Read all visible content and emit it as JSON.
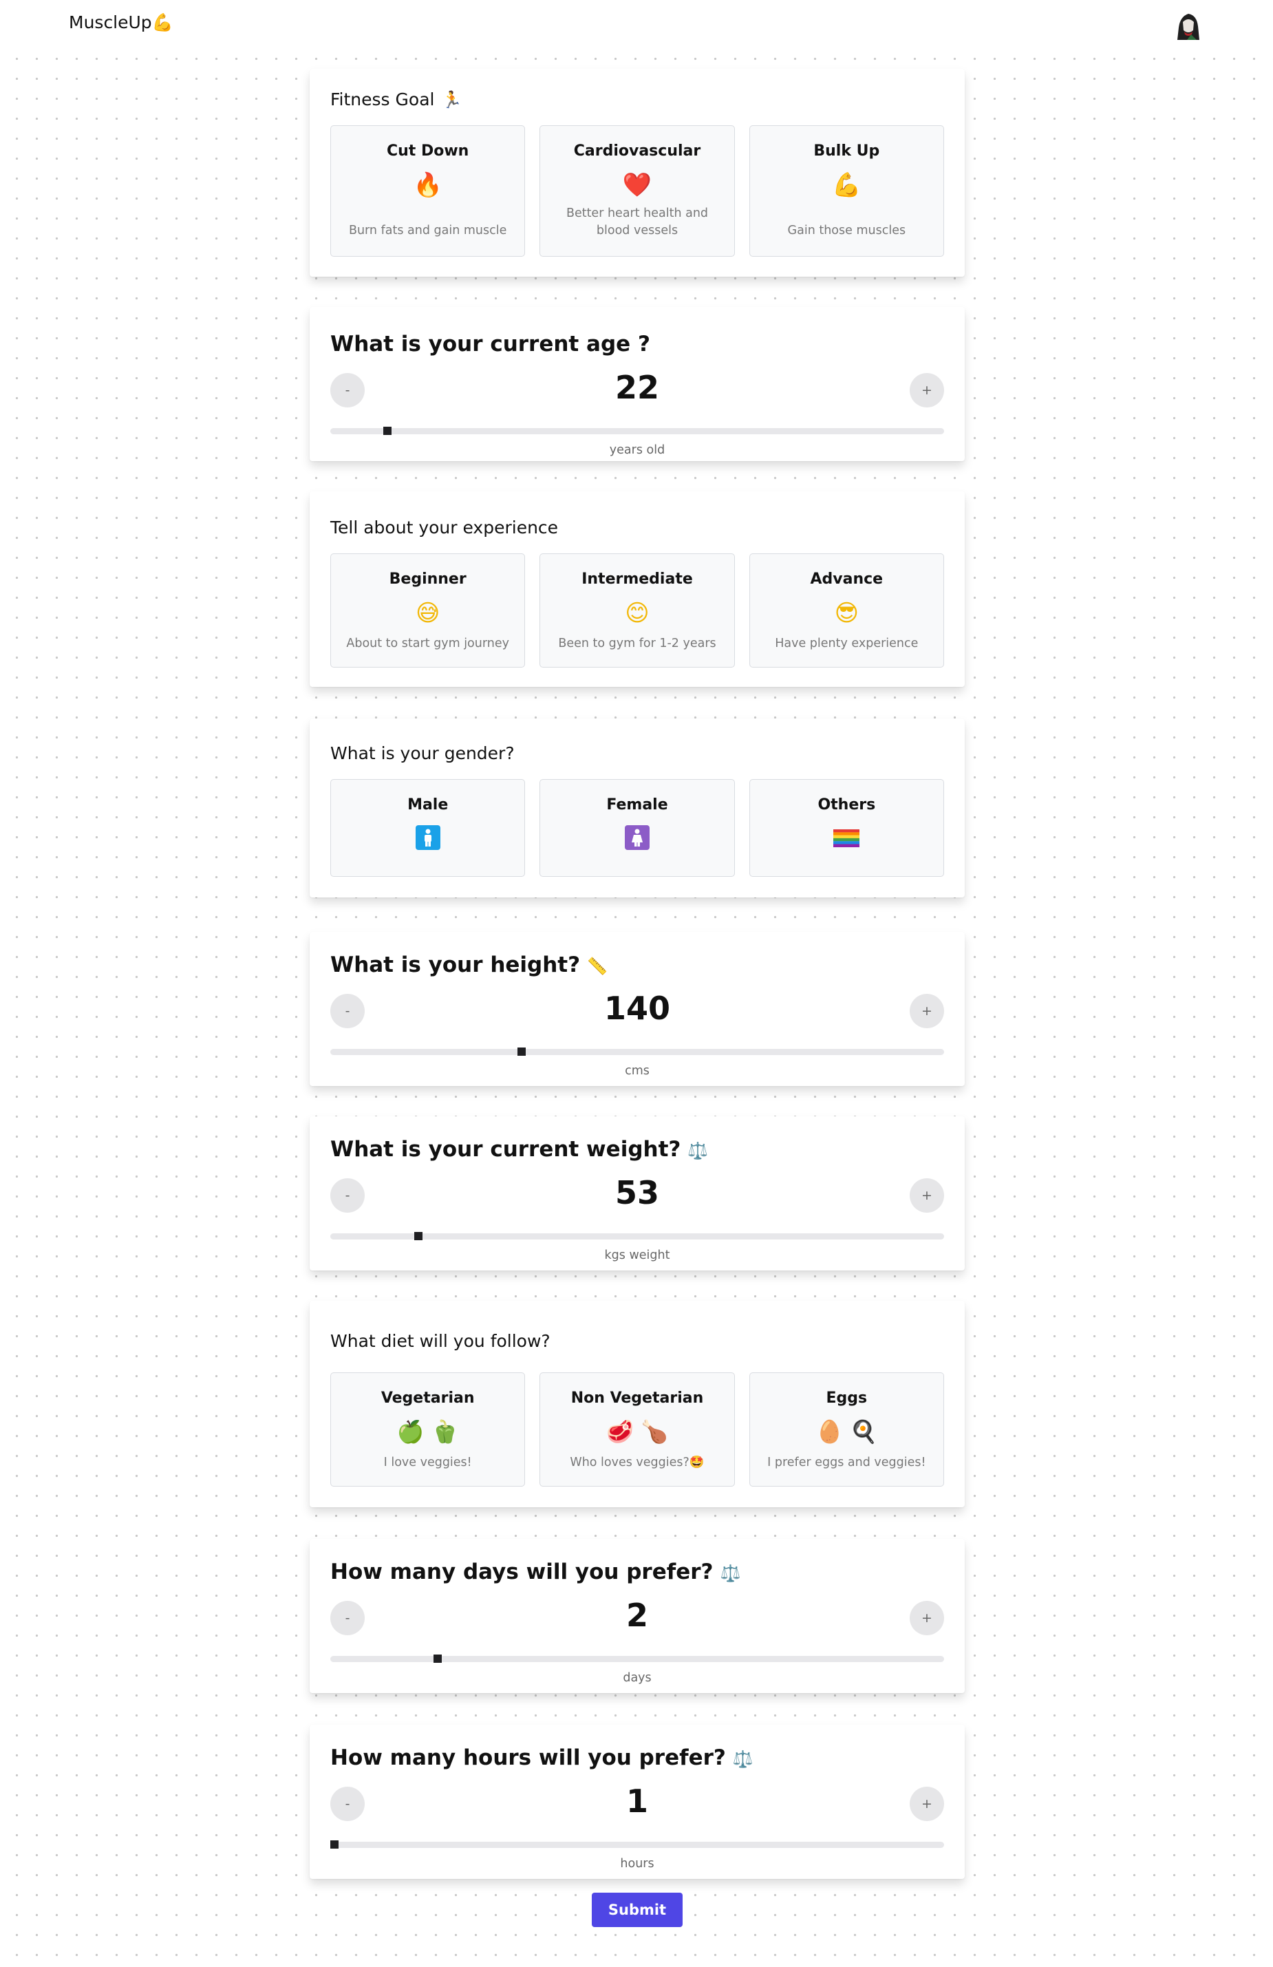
{
  "header": {
    "brand": "MuscleUp",
    "brand_icon": "💪"
  },
  "goal": {
    "title": "Fitness Goal",
    "title_icon": "🏃",
    "options": [
      {
        "title": "Cut Down",
        "icon": "🔥",
        "desc": "Burn fats and gain muscle"
      },
      {
        "title": "Cardiovascular",
        "icon": "❤️",
        "desc": "Better heart health and blood vessels"
      },
      {
        "title": "Bulk Up",
        "icon": "💪",
        "desc": "Gain those muscles"
      }
    ]
  },
  "age": {
    "title": "What is your current age ?",
    "value": "22",
    "unit": "years old",
    "minus": "-",
    "plus": "+",
    "level": 0.087
  },
  "experience": {
    "title": "Tell about your experience",
    "options": [
      {
        "title": "Beginner",
        "icon": "😅",
        "desc": "About to start gym journey"
      },
      {
        "title": "Intermediate",
        "icon": "😊",
        "desc": "Been to gym for 1-2 years"
      },
      {
        "title": "Advance",
        "icon": "😎",
        "desc": "Have plenty experience"
      }
    ]
  },
  "gender": {
    "title": "What is your gender?",
    "options": [
      {
        "title": "Male",
        "icon": "🚹"
      },
      {
        "title": "Female",
        "icon": "🚺"
      },
      {
        "title": "Others",
        "icon": "🏳️‍🌈"
      }
    ]
  },
  "height": {
    "title": "What is your height?",
    "title_icon": "📏",
    "value": "140",
    "unit": "cms",
    "minus": "-",
    "plus": "+",
    "level": 0.309
  },
  "weight": {
    "title": "What is your current weight?",
    "title_icon": "⚖️",
    "value": "53",
    "unit": "kgs weight",
    "minus": "-",
    "plus": "+",
    "level": 0.139
  },
  "diet": {
    "title": "What diet will you follow?",
    "options": [
      {
        "title": "Vegetarian",
        "icons": [
          "🍏",
          "🫑"
        ],
        "desc": "I love veggies!"
      },
      {
        "title": "Non Vegetarian",
        "icons": [
          "🥩",
          "🍗"
        ],
        "desc": "Who loves veggies?🤩"
      },
      {
        "title": "Eggs",
        "icons": [
          "🥚",
          "🍳"
        ],
        "desc": "I prefer eggs and veggies!"
      }
    ]
  },
  "days": {
    "title": "How many days will you prefer?",
    "title_icon": "⚖️",
    "value": "2",
    "unit": "days",
    "minus": "-",
    "plus": "+",
    "level": 0.17
  },
  "hours": {
    "title": "How many hours will you prefer?",
    "title_icon": "⚖️",
    "value": "1",
    "unit": "hours",
    "minus": "-",
    "plus": "+",
    "level": 0.0
  },
  "submit_label": "Submit",
  "colors": {
    "accent": "#4f46e5",
    "track": "#e7e7ea",
    "card_border": "#d9dce1"
  }
}
